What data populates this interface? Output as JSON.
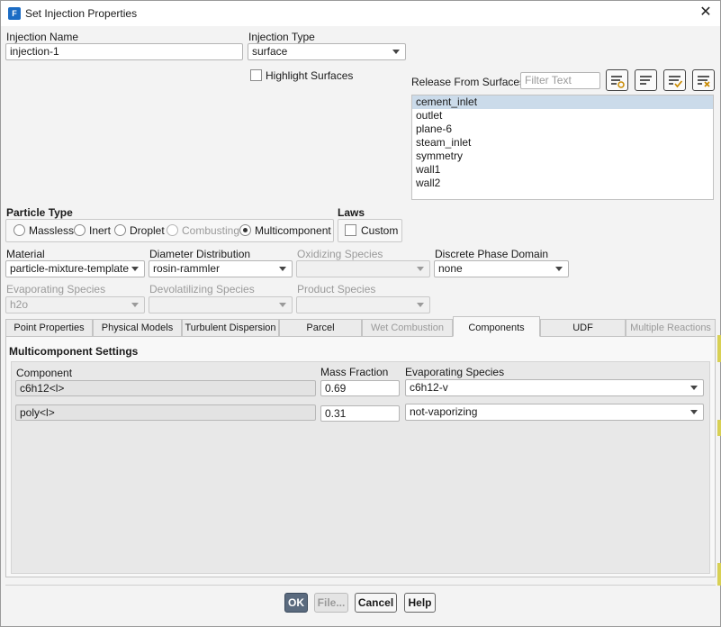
{
  "window": {
    "title": "Set Injection Properties",
    "app_icon_letter": "F"
  },
  "injection_name": {
    "label": "Injection Name",
    "value": "injection-1"
  },
  "injection_type": {
    "label": "Injection Type",
    "value": "surface"
  },
  "highlight_surfaces": {
    "label": "Highlight Surfaces",
    "checked": false
  },
  "release_from_surfaces": {
    "label": "Release From Surfaces",
    "filter_placeholder": "Filter Text",
    "items": [
      "cement_inlet",
      "outlet",
      "plane-6",
      "steam_inlet",
      "symmetry",
      "wall1",
      "wall2"
    ],
    "selected_index": 0
  },
  "particle_type": {
    "label": "Particle Type",
    "options": [
      "Massless",
      "Inert",
      "Droplet",
      "Combusting",
      "Multicomponent"
    ],
    "selected": "Multicomponent",
    "disabled": [
      "Combusting"
    ]
  },
  "laws": {
    "label": "Laws",
    "custom_label": "Custom",
    "custom_checked": false
  },
  "material": {
    "label": "Material",
    "value": "particle-mixture-template"
  },
  "diameter_distribution": {
    "label": "Diameter Distribution",
    "value": "rosin-rammler"
  },
  "oxidizing_species": {
    "label": "Oxidizing Species",
    "value": ""
  },
  "discrete_phase_domain": {
    "label": "Discrete Phase Domain",
    "value": "none"
  },
  "evaporating_species": {
    "label": "Evaporating Species",
    "value": "h2o"
  },
  "devolatilizing_species": {
    "label": "Devolatilizing Species",
    "value": ""
  },
  "product_species": {
    "label": "Product Species",
    "value": ""
  },
  "tabs": [
    {
      "label": "Point Properties",
      "state": "normal"
    },
    {
      "label": "Physical Models",
      "state": "normal"
    },
    {
      "label": "Turbulent Dispersion",
      "state": "normal"
    },
    {
      "label": "Parcel",
      "state": "normal"
    },
    {
      "label": "Wet Combustion",
      "state": "disabled"
    },
    {
      "label": "Components",
      "state": "active"
    },
    {
      "label": "UDF",
      "state": "normal"
    },
    {
      "label": "Multiple Reactions",
      "state": "disabled"
    }
  ],
  "multicomponent": {
    "title": "Multicomponent Settings",
    "headers": {
      "component": "Component",
      "mass_fraction": "Mass Fraction",
      "evaporating_species": "Evaporating Species"
    },
    "rows": [
      {
        "component": "c6h12<l>",
        "mass_fraction": "0.69",
        "evaporating_species": "c6h12-v"
      },
      {
        "component": "poly<l>",
        "mass_fraction": "0.31",
        "evaporating_species": "not-vaporizing"
      }
    ]
  },
  "buttons": {
    "ok": "OK",
    "file": "File...",
    "cancel": "Cancel",
    "help": "Help"
  },
  "colors": {
    "selection": "#cbdbea",
    "primary_button": "#5a6a7e",
    "app_icon": "#1c6cc4"
  }
}
